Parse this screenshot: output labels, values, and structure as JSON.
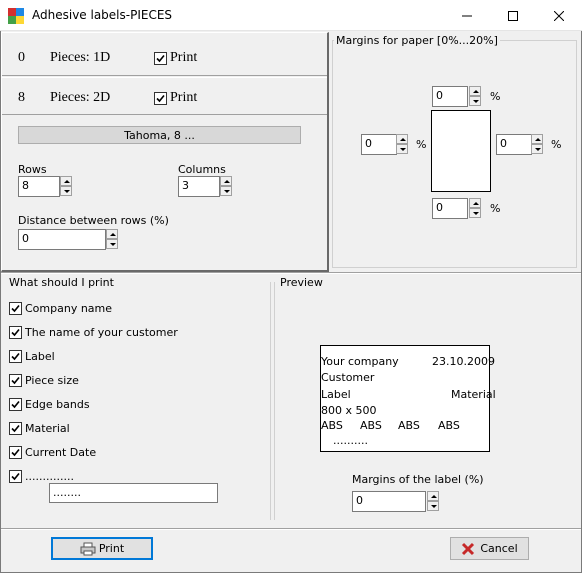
{
  "window": {
    "title": "Adhesive labels-PIECES",
    "minimize_icon": "minimize-icon",
    "maximize_icon": "maximize-icon",
    "close_icon": "close-icon"
  },
  "rows_1d": {
    "count": "0",
    "label": "Pieces: 1D",
    "print_label": "Print",
    "print_checked": true
  },
  "rows_2d": {
    "count": "8",
    "label": "Pieces: 2D",
    "print_label": "Print",
    "print_checked": true
  },
  "font_button": "Tahoma, 8 ...",
  "layout": {
    "rows_label": "Rows",
    "rows_value": "8",
    "columns_label": "Columns",
    "columns_value": "3",
    "distance_label": "Distance between rows (%)",
    "distance_value": "0"
  },
  "margins": {
    "title": "Margins for paper [0%...20%]",
    "top": "0",
    "left": "0",
    "right": "0",
    "bottom": "0",
    "unit": "%"
  },
  "what_print": {
    "title": "What should I print",
    "items": [
      {
        "label": "Company name",
        "checked": true
      },
      {
        "label": "The name of your customer",
        "checked": true
      },
      {
        "label": "Label",
        "checked": true
      },
      {
        "label": "Piece size",
        "checked": true
      },
      {
        "label": "Edge bands",
        "checked": true
      },
      {
        "label": "Material",
        "checked": true
      },
      {
        "label": "Current Date",
        "checked": true
      },
      {
        "label": "..............",
        "checked": true
      }
    ],
    "custom_value": "........"
  },
  "preview": {
    "title": "Preview",
    "company": "Your company",
    "date": "23.10.2009",
    "customer": "Customer",
    "label": "Label",
    "material": "Material",
    "size": "800 x 500",
    "edges": [
      "ABS",
      "ABS",
      "ABS",
      "ABS"
    ],
    "dots": "..........",
    "margins_label": "Margins of the label (%)",
    "margins_value": "0"
  },
  "buttons": {
    "print": "Print",
    "print_icon": "printer-icon",
    "cancel": "Cancel",
    "cancel_icon": "red-x-icon"
  }
}
